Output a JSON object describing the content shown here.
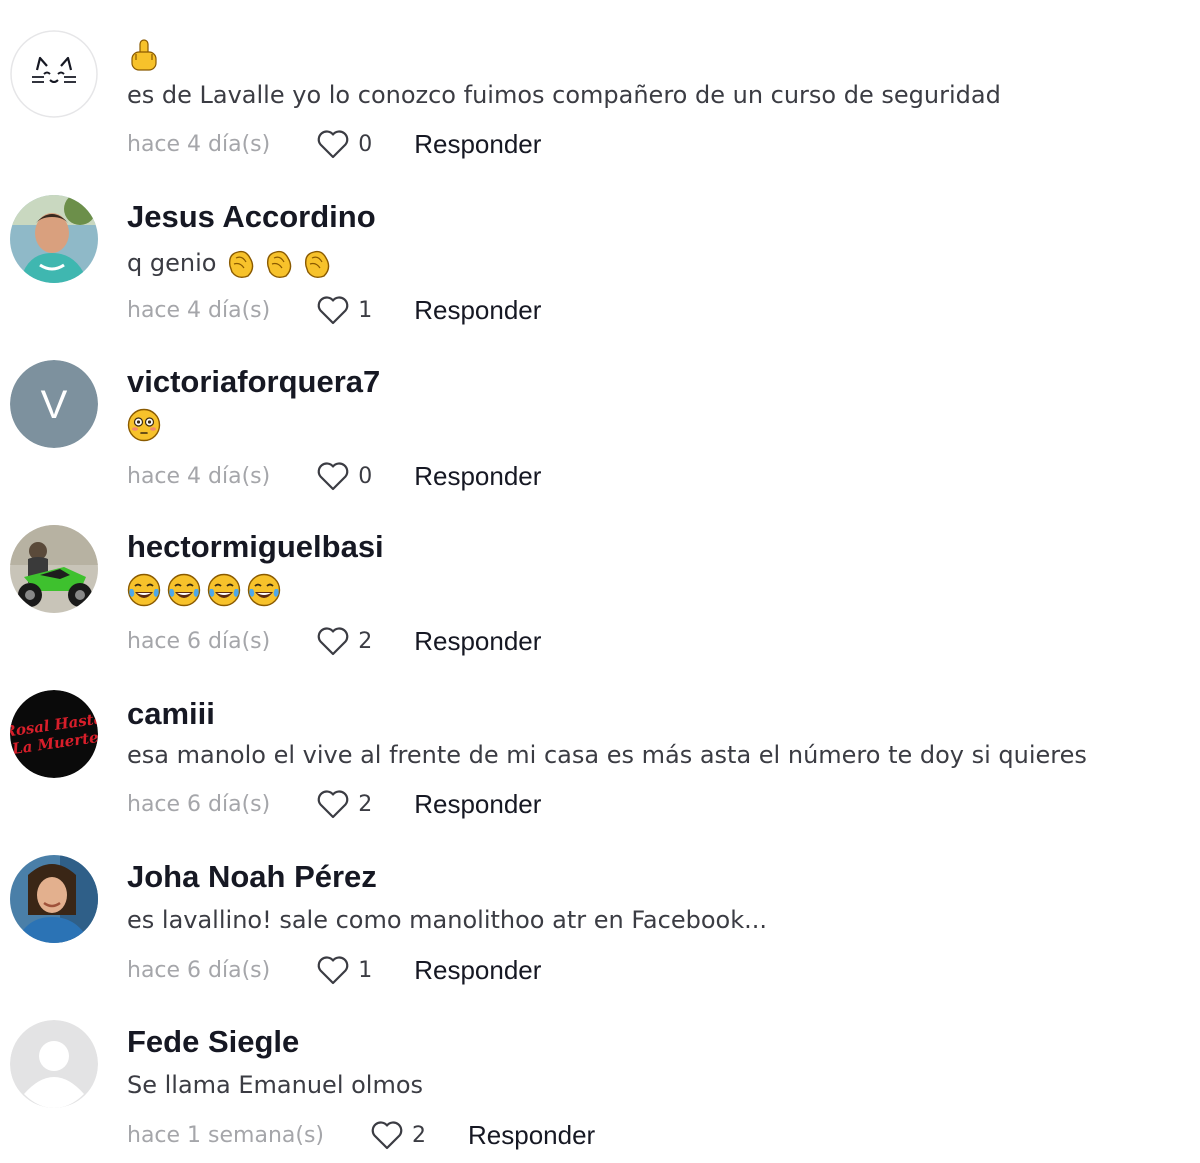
{
  "comments": [
    {
      "author": "",
      "avatar": "cat-face-icon",
      "emoji_line": [
        "middle-finger-emoji"
      ],
      "text": "es de Lavalle yo lo conozco fuimos compañero de un curso de seguridad",
      "time": "hace 4 día(s)",
      "likes": "0",
      "reply_label": "Responder"
    },
    {
      "author": "Jesus Accordino",
      "avatar": "user-photo",
      "text": "q genio",
      "text_emojis": [
        "clapping-hands-emoji",
        "clapping-hands-emoji",
        "clapping-hands-emoji"
      ],
      "time": "hace 4 día(s)",
      "likes": "1",
      "reply_label": "Responder"
    },
    {
      "author": "victoriaforquera7",
      "avatar_letter": "V",
      "emoji_line": [
        "flushed-face-emoji"
      ],
      "time": "hace 4 día(s)",
      "likes": "0",
      "reply_label": "Responder"
    },
    {
      "author": "hectormiguelbasi",
      "avatar": "motorcycle-photo",
      "emoji_line": [
        "tears-of-joy-emoji",
        "tears-of-joy-emoji",
        "tears-of-joy-emoji",
        "tears-of-joy-emoji"
      ],
      "time": "hace 6 día(s)",
      "likes": "2",
      "reply_label": "Responder"
    },
    {
      "author": "camiii",
      "avatar": "red-lettering-logo",
      "avatar_text": "Rosal Hasta La Muerte",
      "text": "esa manolo el vive al frente de mi casa es más asta el número te doy si quieres",
      "time": "hace 6 día(s)",
      "likes": "2",
      "reply_label": "Responder"
    },
    {
      "author": "Joha Noah Pérez",
      "avatar": "user-photo",
      "text": "es lavallino! sale como manolithoo atr en Facebook...",
      "time": "hace 6 día(s)",
      "likes": "1",
      "reply_label": "Responder"
    },
    {
      "author": "Fede Siegle",
      "avatar": "default-user-icon",
      "text": "Se llama Emanuel olmos",
      "time": "hace 1 semana(s)",
      "likes": "2",
      "reply_label": "Responder"
    }
  ],
  "colors": {
    "text_primary": "#161823",
    "text_secondary": "#3b3c43",
    "time_gray": "#a5a6aa",
    "letter_avatar_bg": "#7d919e",
    "emoji_yellow": "#f7c22b"
  }
}
